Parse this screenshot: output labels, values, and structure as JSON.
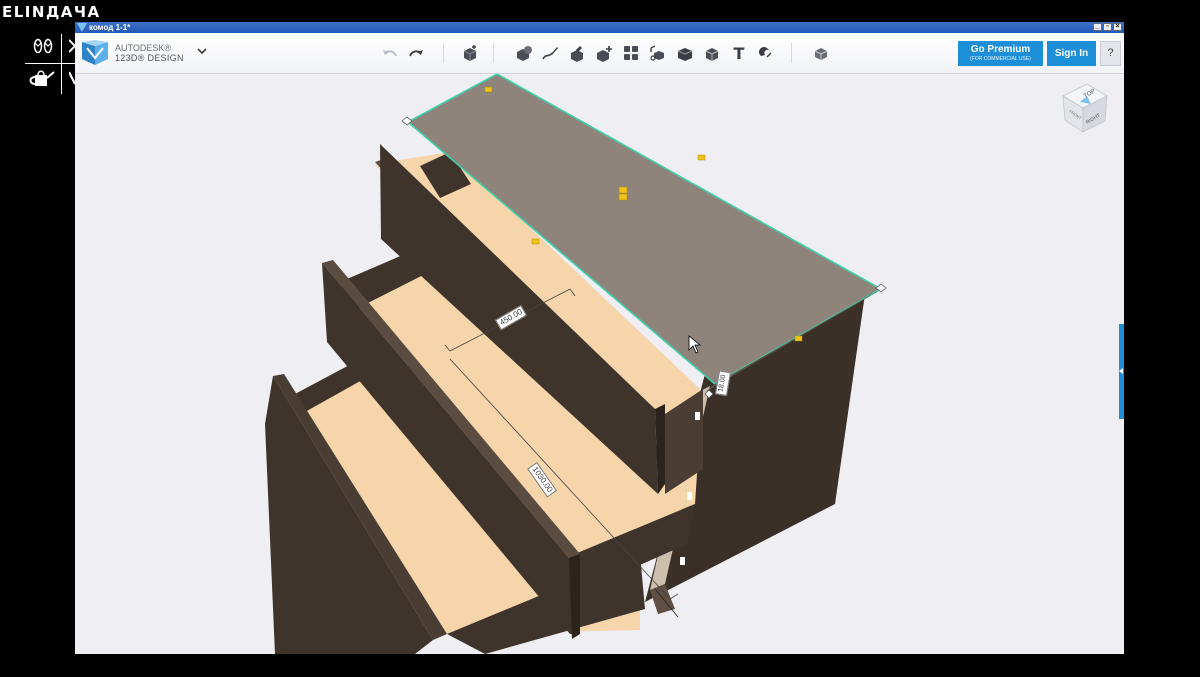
{
  "overlay": {
    "logo_text": "ELINДАЧА"
  },
  "window": {
    "title": "комод 1-1*"
  },
  "brand": {
    "line1": "AUTODESK®",
    "line2": "123D® DESIGN"
  },
  "toolbar": {
    "text_tool_glyph": "T",
    "premium_label": "Go Premium",
    "premium_sub": "(FOR COMMERCIAL USE)",
    "signin_label": "Sign In",
    "help_label": "?"
  },
  "viewcube": {
    "top_label": "TOP",
    "front_label": "FRONT",
    "right_label": "RIGHT"
  },
  "dimensions": {
    "width": "450.00",
    "length": "1030.00",
    "thickness": "18.00"
  },
  "colors": {
    "accent_blue": "#1c8fd8",
    "top_panel": "#8e847c",
    "dark_panel": "#3f342c",
    "drawer_interior": "#f7d5ab",
    "selection_edge": "#3fd0a9",
    "handle_yellow": "#f0c21a"
  }
}
